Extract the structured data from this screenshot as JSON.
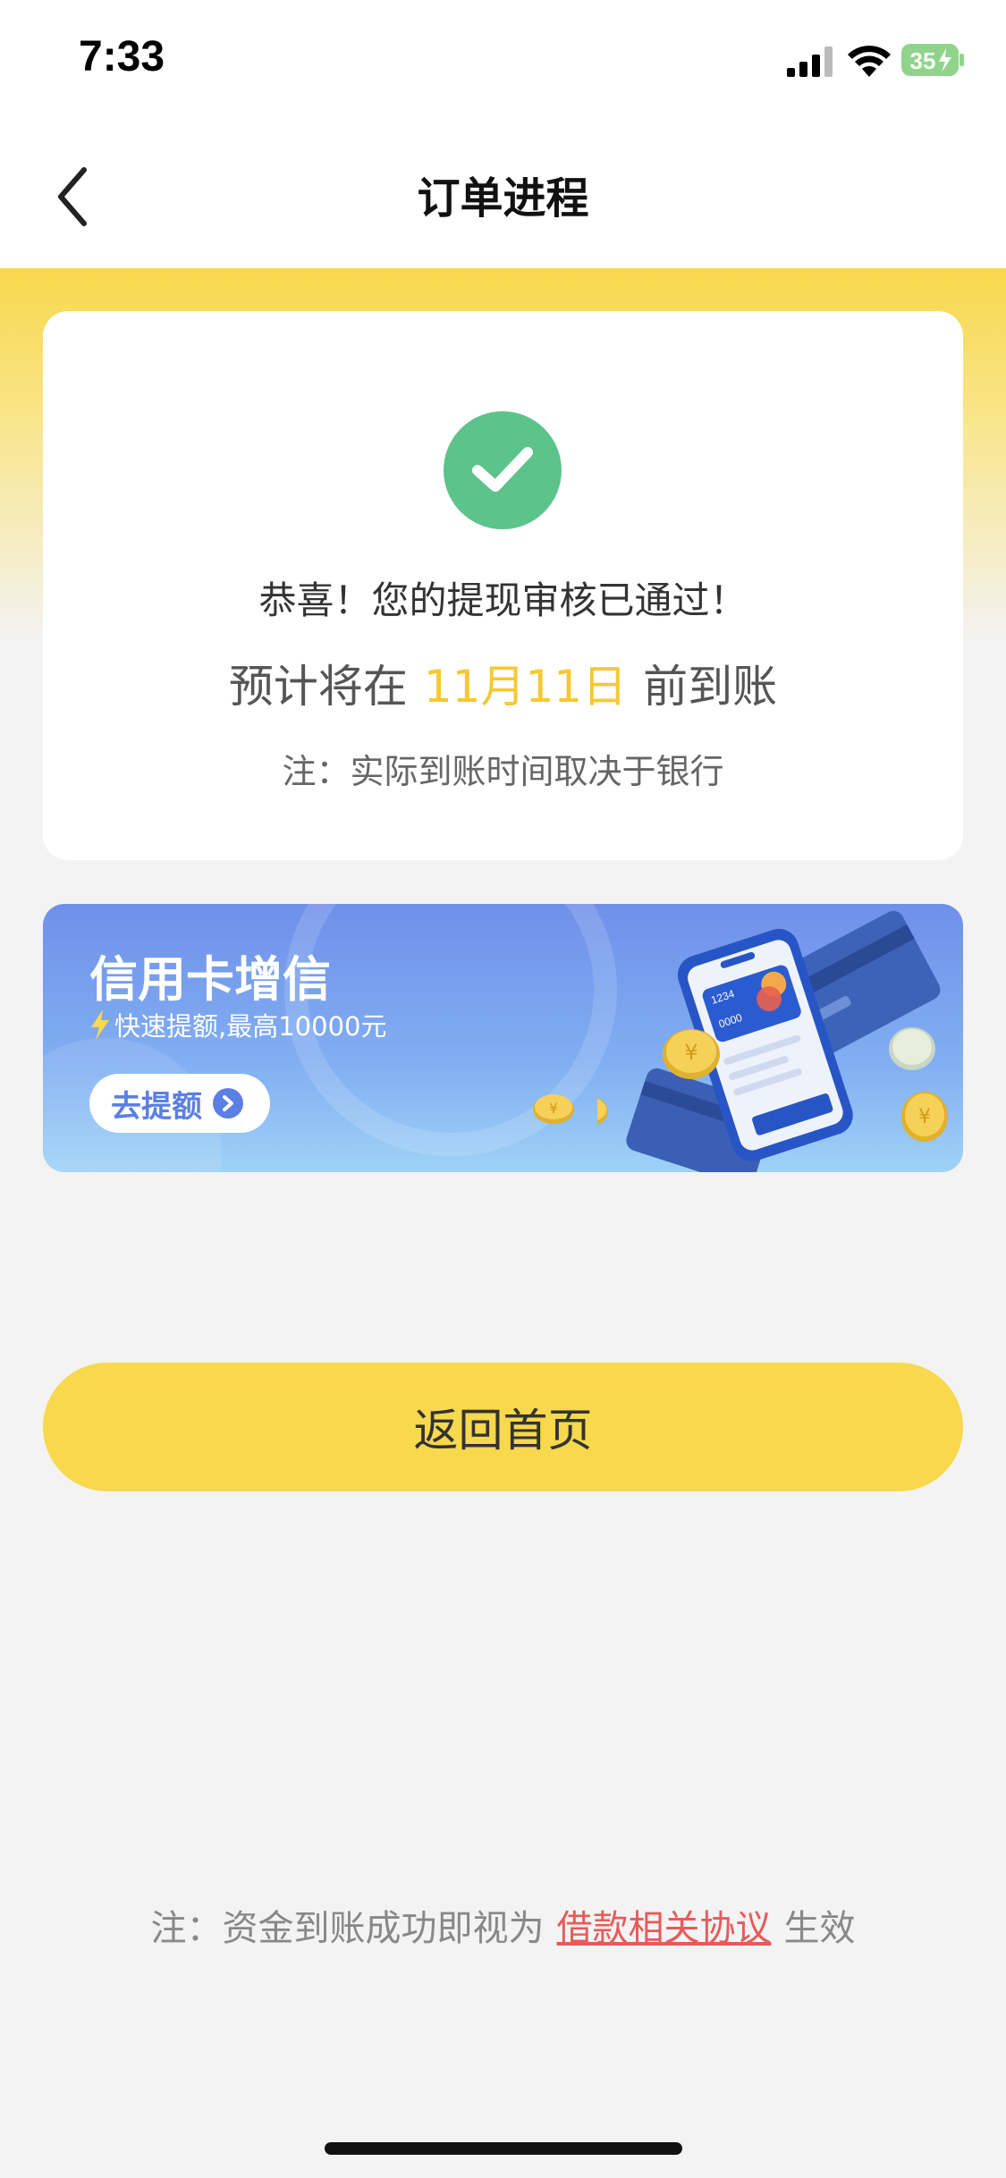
{
  "status_bar": {
    "time": "7:33",
    "battery_level": "35",
    "icons": [
      "signal-icon",
      "wifi-icon",
      "battery-charging-icon"
    ]
  },
  "nav": {
    "title": "订单进程",
    "back_icon": "chevron-left-icon"
  },
  "result": {
    "icon": "check-circle-icon",
    "success_text": "恭喜！您的提现审核已通过！",
    "arrival_prefix": "预计将在",
    "arrival_date": "11月11日",
    "arrival_suffix": "前到账",
    "bank_note": "注：实际到账时间取决于银行"
  },
  "banner": {
    "title": "信用卡增信",
    "subtitle": "快速提额,最高10000元",
    "button_label": "去提额",
    "art_card_number": "1234 0000",
    "colors": {
      "start": "#6f90ea",
      "end": "#9fd2f6"
    }
  },
  "home_button": {
    "label": "返回首页"
  },
  "footer": {
    "prefix": "注：资金到账成功即视为",
    "link_text": "借款相关协议",
    "suffix": "生效"
  },
  "colors": {
    "accent_yellow": "#f8d84c",
    "success_green": "#5cc38a",
    "date_yellow": "#f7c833",
    "link_red": "#e85a5a"
  }
}
